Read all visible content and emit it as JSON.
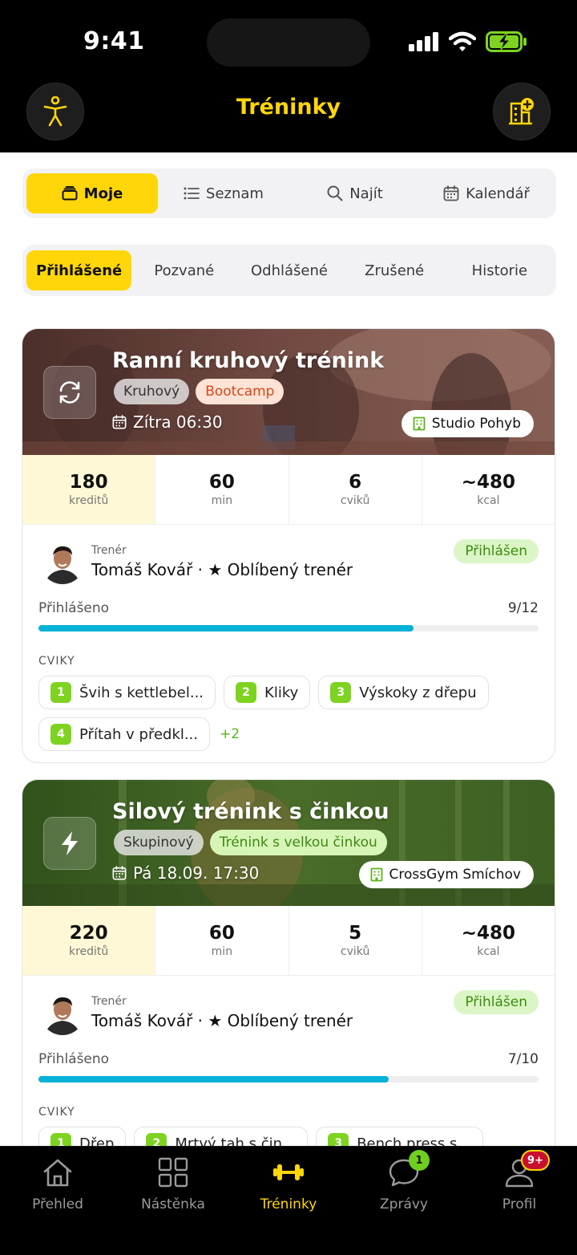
{
  "status_bar": {
    "time": "9:41"
  },
  "header": {
    "title": "Tréninky",
    "left_icon": "accessibility-icon",
    "right_icon": "building-add-icon"
  },
  "view_tabs": [
    {
      "label": "Moje",
      "icon": "tray-icon",
      "active": true
    },
    {
      "label": "Seznam",
      "icon": "list-icon",
      "active": false
    },
    {
      "label": "Najít",
      "icon": "search-icon",
      "active": false
    },
    {
      "label": "Kalendář",
      "icon": "calendar-icon",
      "active": false
    }
  ],
  "filter_tabs": [
    {
      "label": "Přihlášené",
      "active": true
    },
    {
      "label": "Pozvané",
      "active": false
    },
    {
      "label": "Odhlášené",
      "active": false
    },
    {
      "label": "Zrušené",
      "active": false
    },
    {
      "label": "Historie",
      "active": false
    }
  ],
  "trainings": [
    {
      "title": "Ranní kruhový trénink",
      "icon": "refresh-icon",
      "tags": [
        {
          "label": "Kruhový",
          "style": "gray"
        },
        {
          "label": "Bootcamp",
          "style": "orange"
        }
      ],
      "date": "Zítra 06:30",
      "venue": "Studio Pohyb",
      "stats": [
        {
          "value": "180",
          "label": "kreditů"
        },
        {
          "value": "60",
          "label": "min"
        },
        {
          "value": "6",
          "label": "cviků"
        },
        {
          "value": "~480",
          "label": "kcal"
        }
      ],
      "trainer_caption": "Trenér",
      "trainer_name": "Tomáš Kovář · ★ Oblíbený trenér",
      "status": "Přihlášen",
      "signup_label": "Přihlášeno",
      "signup_count": "9/12",
      "signup_fraction": 0.75,
      "exercises_heading": "CVIKY",
      "exercises": [
        {
          "num": "1",
          "name": "Švih s kettlebel..."
        },
        {
          "num": "2",
          "name": "Kliky"
        },
        {
          "num": "3",
          "name": "Výskoky z dřepu"
        },
        {
          "num": "4",
          "name": "Přítah v předkl..."
        }
      ],
      "more": "+2"
    },
    {
      "title": "Silový trénink s činkou",
      "icon": "lightning-icon",
      "tags": [
        {
          "label": "Skupinový",
          "style": "gray"
        },
        {
          "label": "Trénink s velkou činkou",
          "style": "green"
        }
      ],
      "date": "Pá 18.09. 17:30",
      "venue": "CrossGym Smíchov",
      "stats": [
        {
          "value": "220",
          "label": "kreditů"
        },
        {
          "value": "60",
          "label": "min"
        },
        {
          "value": "5",
          "label": "cviků"
        },
        {
          "value": "~480",
          "label": "kcal"
        }
      ],
      "trainer_caption": "Trenér",
      "trainer_name": "Tomáš Kovář · ★ Oblíbený trenér",
      "status": "Přihlášen",
      "signup_label": "Přihlášeno",
      "signup_count": "7/10",
      "signup_fraction": 0.7,
      "exercises_heading": "CVIKY",
      "exercises": [
        {
          "num": "1",
          "name": "Dřep"
        },
        {
          "num": "2",
          "name": "Mrtvý tah s čin..."
        },
        {
          "num": "3",
          "name": "Bench press s..."
        }
      ]
    }
  ],
  "tab_bar": [
    {
      "label": "Přehled",
      "icon": "home-icon",
      "active": false
    },
    {
      "label": "Nástěnka",
      "icon": "grid-icon",
      "active": false
    },
    {
      "label": "Tréninky",
      "icon": "dumbbell-icon",
      "active": true
    },
    {
      "label": "Zprávy",
      "icon": "chat-icon",
      "active": false,
      "badge": "1"
    },
    {
      "label": "Profil",
      "icon": "person-icon",
      "active": false,
      "badge": "9+"
    }
  ],
  "colors": {
    "accent": "#ffd60a",
    "progress": "#06b2d6",
    "exercise_number": "#7ed321",
    "status_green": "#3a8e0f"
  }
}
